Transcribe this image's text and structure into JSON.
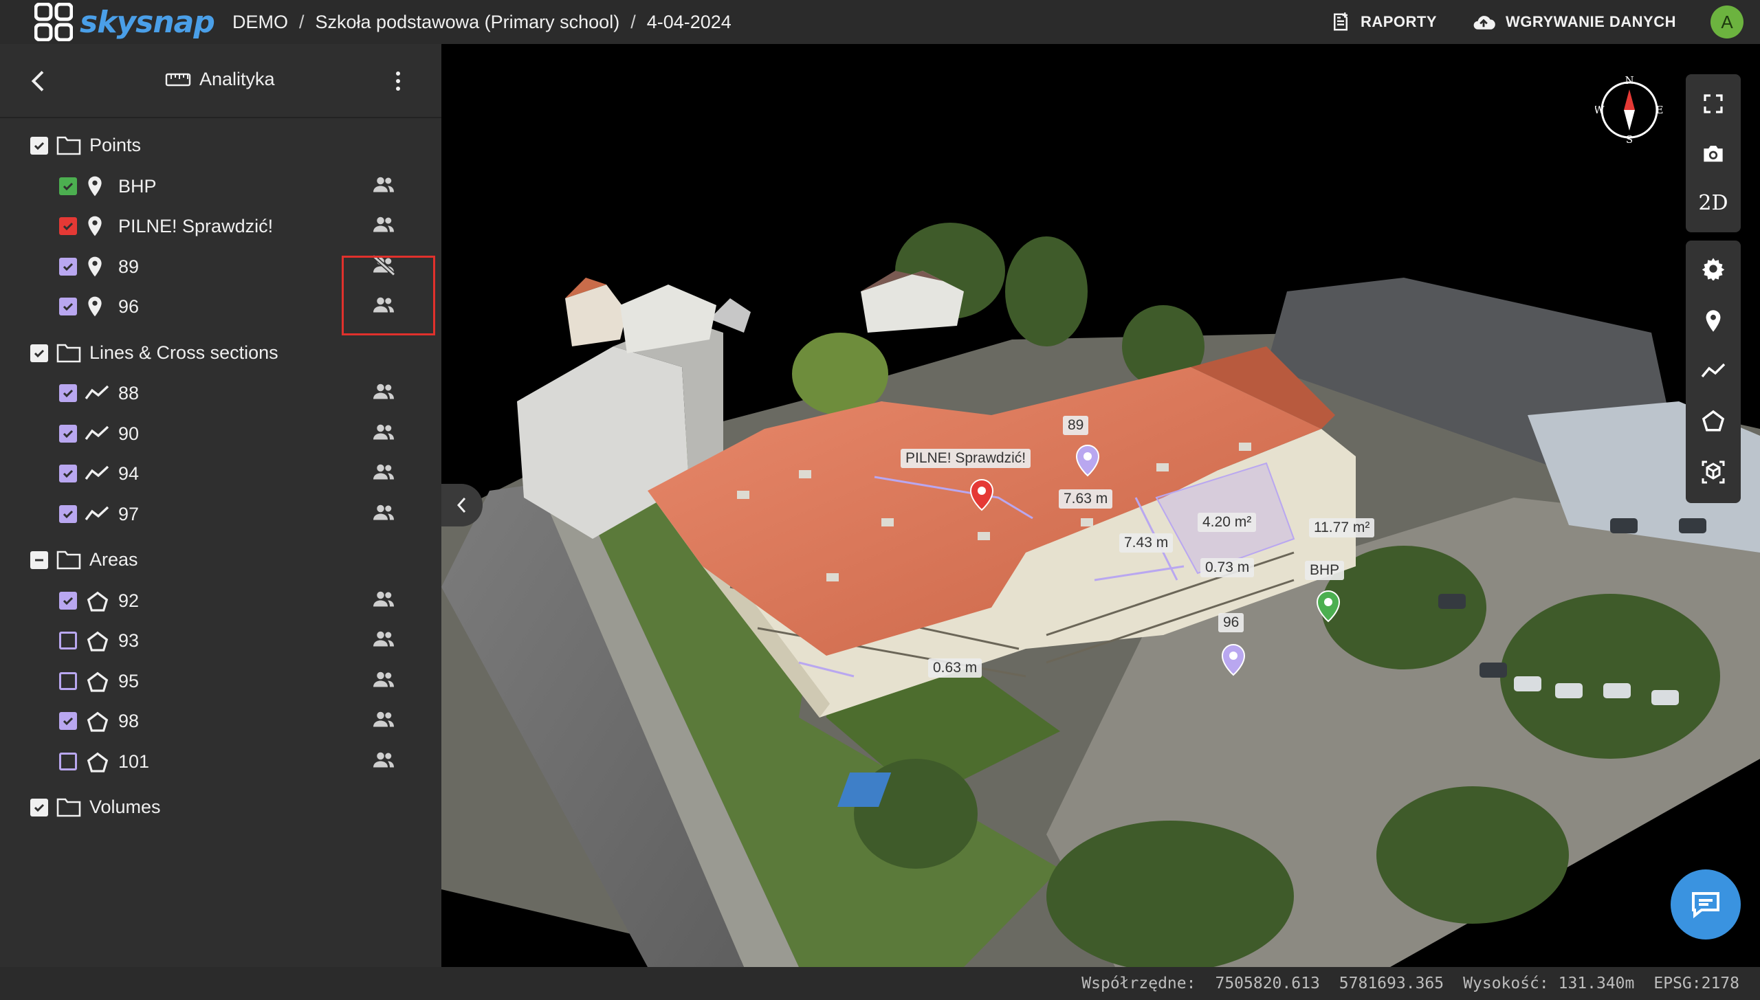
{
  "app": {
    "logo_text": "skysnap"
  },
  "breadcrumb": [
    "DEMO",
    "Szkoła podstawowa (Primary school)",
    "4-04-2024"
  ],
  "header": {
    "reports_label": "RAPORTY",
    "upload_label": "WGRYWANIE DANYCH",
    "avatar_initial": "A"
  },
  "sidebar": {
    "title": "Analityka",
    "groups": [
      {
        "label": "Points",
        "state": "checked",
        "items": [
          {
            "label": "BHP",
            "icon": "map-pin-icon",
            "checked": true,
            "color": "#4caf50",
            "shared": true
          },
          {
            "label": "PILNE! Sprawdzić!",
            "icon": "map-pin-icon",
            "checked": true,
            "color": "#e53935",
            "shared": true
          },
          {
            "label": "89",
            "icon": "map-pin-icon",
            "checked": true,
            "color": "#b9a7f0",
            "shared": false
          },
          {
            "label": "96",
            "icon": "map-pin-icon",
            "checked": true,
            "color": "#b9a7f0",
            "shared": true
          }
        ]
      },
      {
        "label": "Lines & Cross sections",
        "state": "checked",
        "items": [
          {
            "label": "88",
            "icon": "polyline-icon",
            "checked": true,
            "color": "#b9a7f0",
            "shared": true
          },
          {
            "label": "90",
            "icon": "polyline-icon",
            "checked": true,
            "color": "#b9a7f0",
            "shared": true
          },
          {
            "label": "94",
            "icon": "polyline-icon",
            "checked": true,
            "color": "#b9a7f0",
            "shared": true
          },
          {
            "label": "97",
            "icon": "polyline-icon",
            "checked": true,
            "color": "#b9a7f0",
            "shared": true
          }
        ]
      },
      {
        "label": "Areas",
        "state": "indeterminate",
        "items": [
          {
            "label": "92",
            "icon": "pentagon-icon",
            "checked": true,
            "color": "#b9a7f0",
            "shared": true
          },
          {
            "label": "93",
            "icon": "pentagon-icon",
            "checked": false,
            "color": "#b9a7f0",
            "shared": true
          },
          {
            "label": "95",
            "icon": "pentagon-icon",
            "checked": false,
            "color": "#b9a7f0",
            "shared": true
          },
          {
            "label": "98",
            "icon": "pentagon-icon",
            "checked": true,
            "color": "#b9a7f0",
            "shared": true
          },
          {
            "label": "101",
            "icon": "pentagon-icon",
            "checked": false,
            "color": "#b9a7f0",
            "shared": true
          }
        ]
      },
      {
        "label": "Volumes",
        "state": "checked",
        "items": []
      }
    ]
  },
  "map": {
    "labels": [
      {
        "id": "pilne",
        "text": "PILNE! Sprawdzić!"
      },
      {
        "id": "p89",
        "text": "89"
      },
      {
        "id": "m763",
        "text": "7.63 m"
      },
      {
        "id": "a420",
        "text": "4.20 m²"
      },
      {
        "id": "a1177",
        "text": "11.77 m²"
      },
      {
        "id": "m743",
        "text": "7.43 m"
      },
      {
        "id": "m073",
        "text": "0.73 m"
      },
      {
        "id": "bhp",
        "text": "BHP"
      },
      {
        "id": "p96",
        "text": "96"
      },
      {
        "id": "m063",
        "text": "0.63 m"
      }
    ],
    "compass": {
      "n": "N",
      "s": "S",
      "e": "E",
      "w": "W"
    },
    "toolbar": {
      "mode_2d": "2D"
    }
  },
  "status": {
    "coord_label": "Współrzędne:",
    "x": "7505820.613",
    "y": "5781693.365",
    "height_label": "Wysokość: 131.340m",
    "epsg": "EPSG:2178"
  },
  "colors": {
    "accent": "#4a9fe8",
    "highlight": "#e0312c",
    "measure": "#b9a7f0"
  }
}
